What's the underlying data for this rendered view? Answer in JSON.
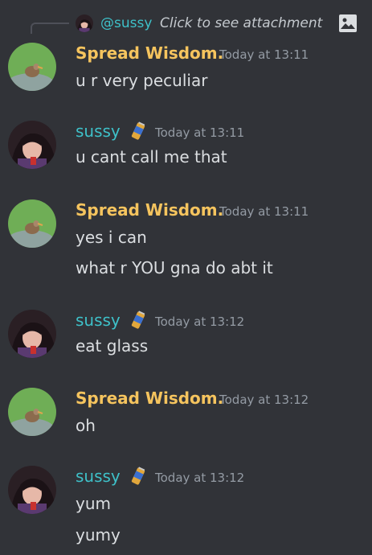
{
  "reply": {
    "username": "@sussy",
    "text": "Click to see attachment",
    "icon": "image-icon"
  },
  "messages": [
    {
      "username": "Spread Wisdom.",
      "timestamp": "Today at 13:11",
      "avatar": "bird-avatar",
      "lines": [
        "u r very peculiar"
      ]
    },
    {
      "username": "sussy",
      "timestamp": "Today at 13:11",
      "avatar": "anime-avatar",
      "badge": "soda-can-icon",
      "lines": [
        "u cant call me that"
      ]
    },
    {
      "username": "Spread Wisdom.",
      "timestamp": "Today at 13:11",
      "avatar": "bird-avatar",
      "lines": [
        "yes i can",
        "what r YOU gna do abt it"
      ]
    },
    {
      "username": "sussy",
      "timestamp": "Today at 13:12",
      "avatar": "anime-avatar",
      "badge": "soda-can-icon",
      "lines": [
        "eat glass"
      ]
    },
    {
      "username": "Spread Wisdom.",
      "timestamp": "Today at 13:12",
      "avatar": "bird-avatar",
      "lines": [
        "oh"
      ]
    },
    {
      "username": "sussy",
      "timestamp": "Today at 13:12",
      "avatar": "anime-avatar",
      "badge": "soda-can-icon",
      "lines": [
        "yum",
        "yumy"
      ]
    }
  ],
  "colors": {
    "background": "#313338",
    "spread_wisdom_name": "#f5c45e",
    "sussy_name": "#3ec1c9",
    "message_text": "#dbdee1",
    "timestamp": "#949ba4"
  }
}
